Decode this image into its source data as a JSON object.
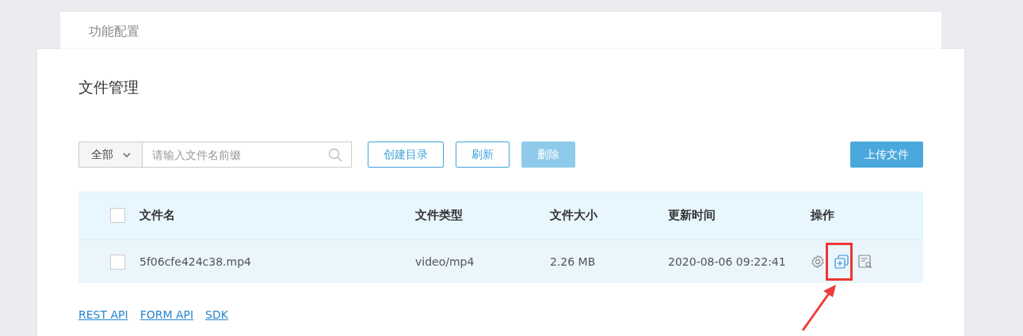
{
  "back_card": {
    "title": "功能配置"
  },
  "page_title": "文件管理",
  "toolbar": {
    "filter": {
      "value": "全部"
    },
    "search": {
      "placeholder": "请输入文件名前缀"
    },
    "buttons": [
      {
        "label": "创建目录",
        "disabled": false
      },
      {
        "label": "刷新",
        "disabled": false
      },
      {
        "label": "删除",
        "disabled": true
      }
    ],
    "upload_button": "上传文件"
  },
  "table": {
    "columns": [
      "文件名",
      "文件类型",
      "文件大小",
      "更新时间",
      "操作"
    ],
    "header_checked": false,
    "rows": [
      {
        "checked": false,
        "cells": [
          "5f06cfe424c38.mp4",
          "video/mp4",
          "2.26 MB",
          "2020-08-06 09:22:41"
        ],
        "actions": [
          {
            "kind": "settings",
            "highlighted": false
          },
          {
            "kind": "copy",
            "highlighted": true
          },
          {
            "kind": "preview",
            "highlighted": false
          }
        ]
      }
    ]
  },
  "links": [
    "REST API",
    "FORM API",
    "SDK"
  ]
}
